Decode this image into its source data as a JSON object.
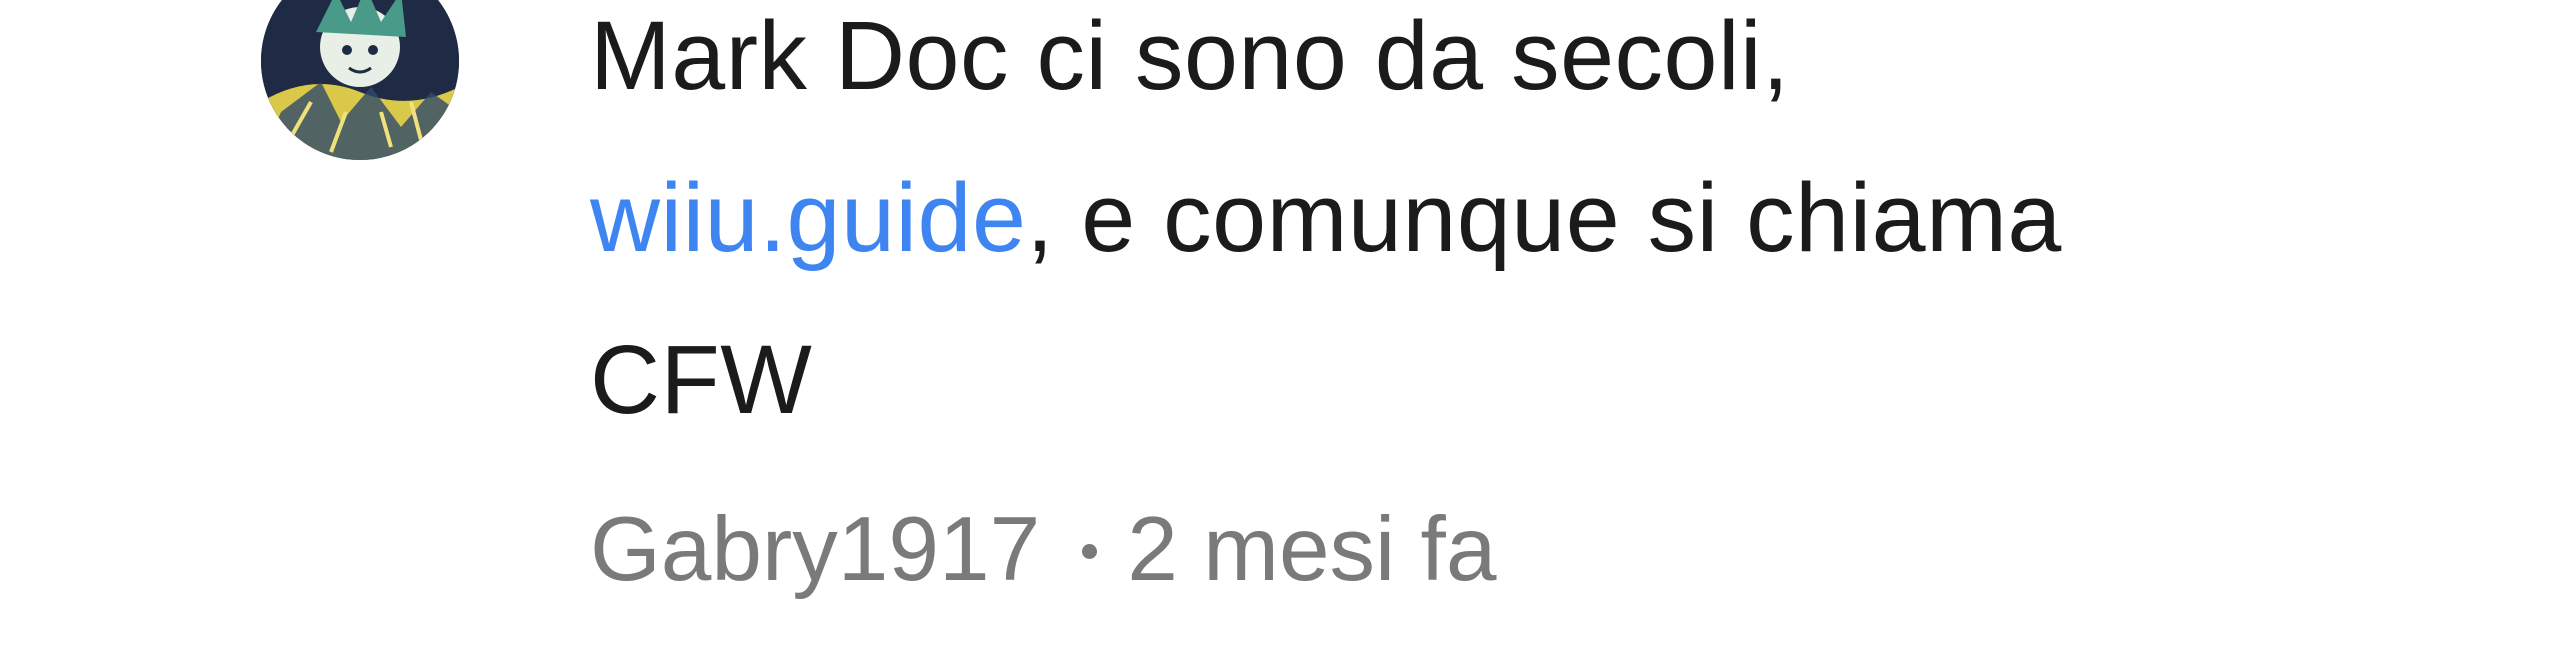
{
  "comment": {
    "line1": "Mark Doc ci sono da secoli,",
    "link_text": "wiiu.guide",
    "line2_rest": ", e comunque si chiama",
    "line3": "CFW",
    "author": "Gabry1917",
    "separator_icon": "bullet-dot",
    "time_ago": "2 mesi fa",
    "link_color": "#3f85f2",
    "text_color": "#1b1b1b",
    "meta_color": "#7a7a7a"
  }
}
